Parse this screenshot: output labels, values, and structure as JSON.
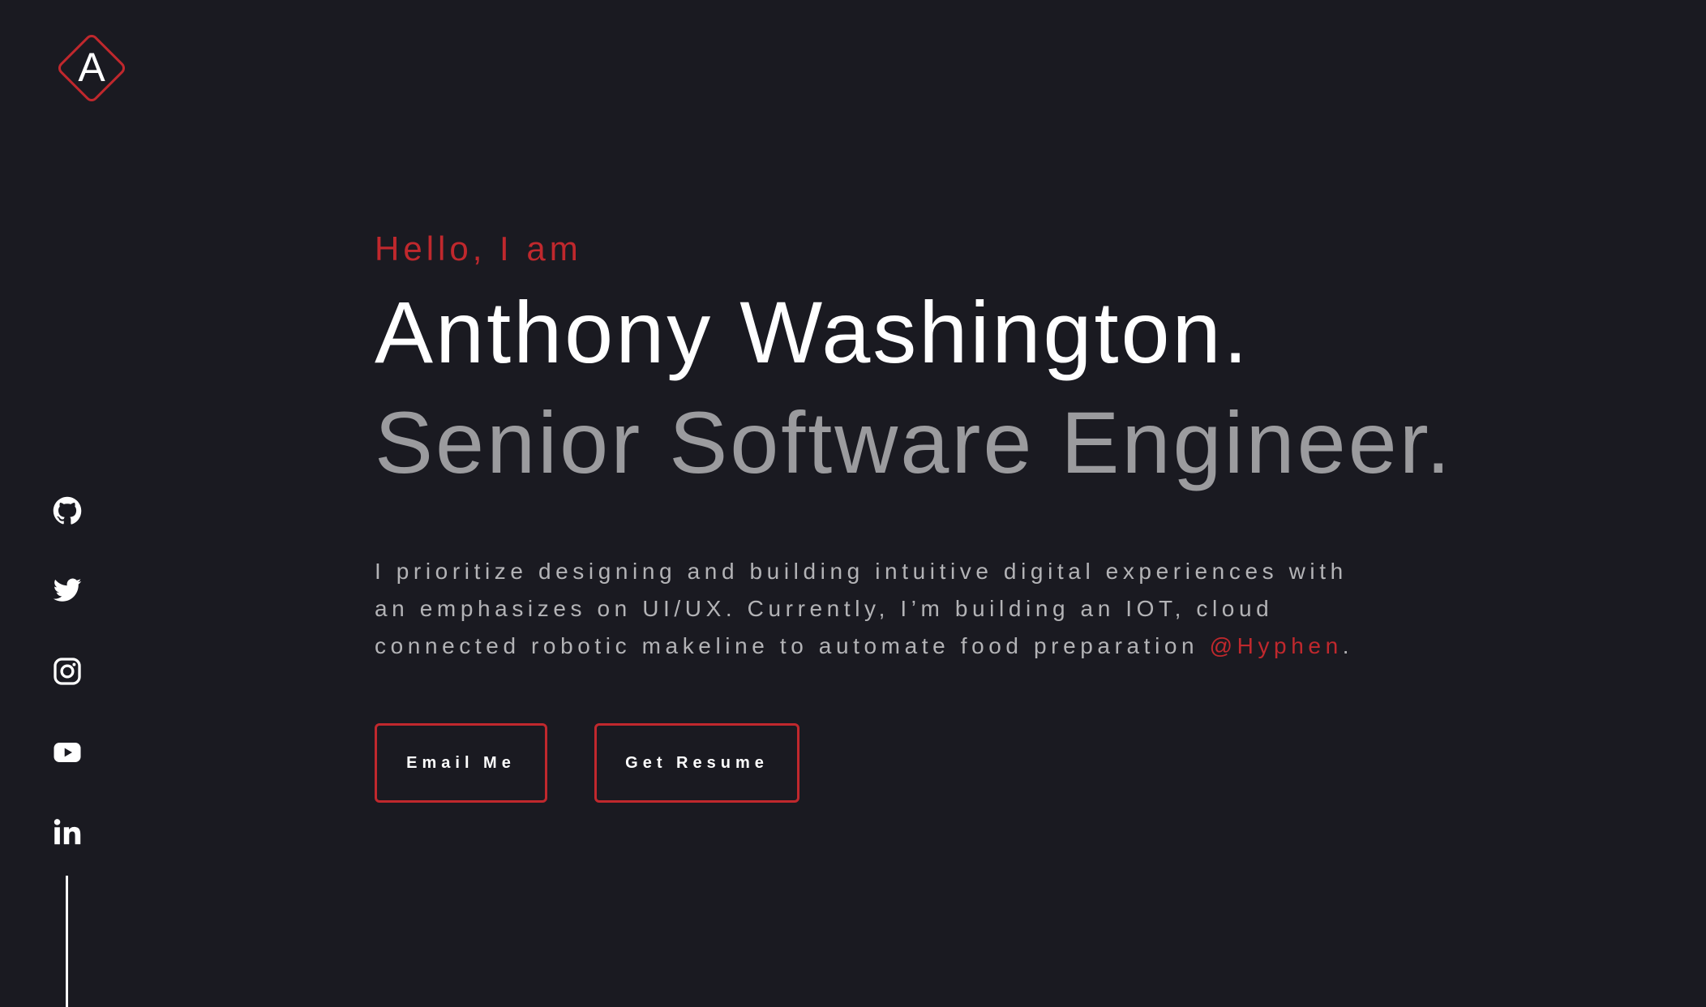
{
  "logo": {
    "letter": "A",
    "accent": "#c0282d"
  },
  "social": [
    {
      "name": "github-icon"
    },
    {
      "name": "twitter-icon"
    },
    {
      "name": "instagram-icon"
    },
    {
      "name": "youtube-icon"
    },
    {
      "name": "linkedin-icon"
    }
  ],
  "hero": {
    "greeting": "Hello, I am",
    "name": "Anthony Washington.",
    "role": "Senior Software Engineer.",
    "description": "I prioritize designing and building intuitive digital experiences with an emphasizes on UI/UX. Currently, I’m building an IOT, cloud connected robotic makeline to automate food preparation ",
    "highlight": "@Hyphen",
    "description_end": "."
  },
  "buttons": {
    "email": "Email Me",
    "resume": "Get Resume"
  },
  "colors": {
    "background": "#1a1a21",
    "accent": "#c0282d",
    "text": "#ffffff",
    "muted": "#9b9b9e"
  }
}
